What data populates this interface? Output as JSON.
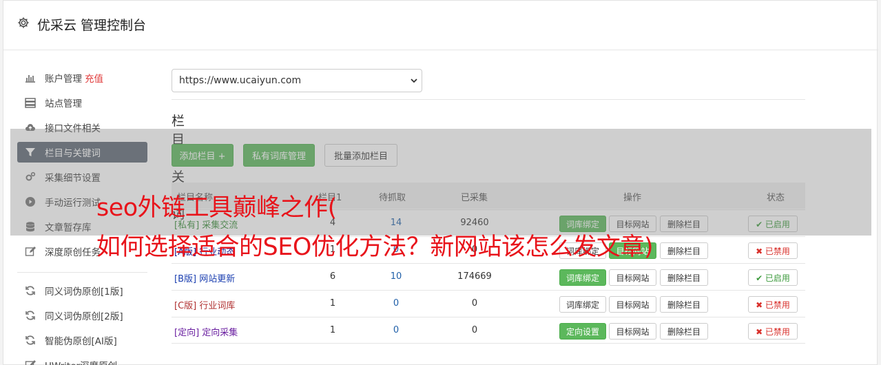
{
  "header": {
    "title": "优采云 管理控制台",
    "icon": "gear-icon"
  },
  "sidebar": {
    "items": [
      {
        "label": "账户管理",
        "extra": "充值",
        "icon": "bar-chart-icon"
      },
      {
        "label": "站点管理",
        "icon": "server-icon"
      },
      {
        "label": "接口文件相关",
        "icon": "cloud-upload-icon"
      },
      {
        "label": "栏目与关键词",
        "icon": "filter-icon",
        "active": true
      },
      {
        "label": "采集细节设置",
        "icon": "cogs-icon"
      },
      {
        "label": "手动运行测试",
        "icon": "play-circle-icon"
      },
      {
        "label": "文章暂存库",
        "icon": "database-icon"
      },
      {
        "label": "深度原创任务",
        "icon": "edit-icon"
      },
      {
        "label": "同义词伪原创[1版]",
        "icon": "refresh-icon"
      },
      {
        "label": "同义词伪原创[2版]",
        "icon": "refresh-icon"
      },
      {
        "label": "智能伪原创[AI版]",
        "icon": "refresh-icon"
      },
      {
        "label": "UWriter深度原创",
        "icon": "edit-icon"
      }
    ]
  },
  "site_select": {
    "value": "https://www.ucaiyun.com"
  },
  "section": {
    "title": "栏目与关键词"
  },
  "buttons": {
    "add_column": "添加栏目 +",
    "private_lib": "私有词库管理",
    "batch_add": "批量添加栏目"
  },
  "table": {
    "headers": {
      "name": "栏目名称",
      "columns": "栏目1",
      "pending": "待抓取",
      "collected": "已采集",
      "actions": "操作",
      "status": "状态"
    },
    "rows": [
      {
        "tag": "[私有]",
        "name": "采集交流",
        "columns": "4",
        "pending": "14",
        "collected": "92460",
        "bind": "词库绑定",
        "target": "目标网站",
        "delete": "删除栏目",
        "status": "✔ 已启用"
      },
      {
        "tag": "[A版]",
        "name": "行业动态",
        "columns": "1",
        "pending": "0",
        "collected": "0",
        "bind": "词库绑定",
        "target": "目标网站",
        "delete": "删除栏目",
        "status": "✖ 已禁用"
      },
      {
        "tag": "[B版]",
        "name": "网站更新",
        "columns": "6",
        "pending": "10",
        "collected": "174669",
        "bind": "词库绑定",
        "target": "目标网站",
        "delete": "删除栏目",
        "status": "✔ 已启用"
      },
      {
        "tag": "[C版]",
        "name": "行业词库",
        "columns": "1",
        "pending": "0",
        "collected": "0",
        "bind": "词库绑定",
        "target": "目标网站",
        "delete": "删除栏目",
        "status": "✖ 已禁用"
      },
      {
        "tag": "[定向]",
        "name": "定向采集",
        "columns": "1",
        "pending": "0",
        "collected": "0",
        "bind": "定向设置",
        "target": "目标网站",
        "delete": "删除栏目",
        "status": "✖ 已禁用"
      }
    ]
  },
  "overlay": {
    "line1": "seo外链工具巅峰之作(",
    "line2": "如何选择适合的SEO优化方法？新网站该怎么发文章)"
  },
  "colors": {
    "accent_green": "#5cb85c",
    "active_nav": "#5e6874",
    "overlay_text": "#e8141b",
    "enabled": "#3c9a3c",
    "disabled": "#d9302b"
  }
}
